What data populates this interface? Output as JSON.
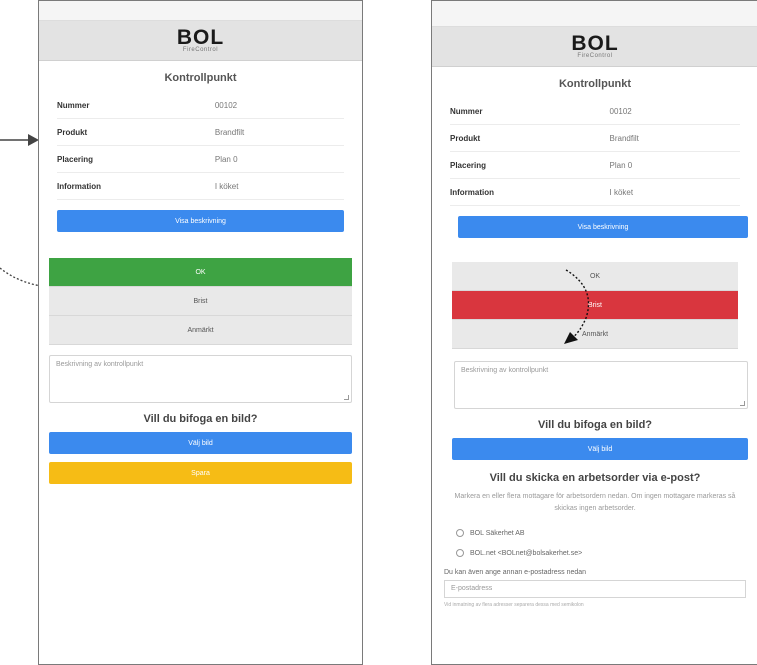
{
  "brand": {
    "name": "BOL",
    "tagline": "FireControl"
  },
  "left": {
    "title": "Kontrollpunkt",
    "rows": [
      {
        "label": "Nummer",
        "value": "00102"
      },
      {
        "label": "Produkt",
        "value": "Brandfilt"
      },
      {
        "label": "Placering",
        "value": "Plan 0"
      },
      {
        "label": "Information",
        "value": "I köket"
      }
    ],
    "show_description": "Visa beskrivning",
    "status": {
      "ok": "OK",
      "fail": "Brist",
      "remark": "Anmärkt"
    },
    "textarea_placeholder": "Beskrivning av kontrollpunkt",
    "attach_heading": "Vill du bifoga en bild?",
    "choose_image": "Välj bild",
    "save": "Spara"
  },
  "right": {
    "title": "Kontrollpunkt",
    "rows": [
      {
        "label": "Nummer",
        "value": "00102"
      },
      {
        "label": "Produkt",
        "value": "Brandfilt"
      },
      {
        "label": "Placering",
        "value": "Plan 0"
      },
      {
        "label": "Information",
        "value": "I köket"
      }
    ],
    "show_description": "Visa beskrivning",
    "status": {
      "ok": "OK",
      "fail": "Brist",
      "remark": "Anmärkt"
    },
    "textarea_placeholder": "Beskrivning av kontrollpunkt",
    "attach_heading": "Vill du bifoga en bild?",
    "choose_image": "Välj bild",
    "workorder_heading": "Vill du skicka en arbetsorder via e-post?",
    "workorder_hint": "Markera en eller flera mottagare för arbetsordern nedan. Om ingen mottagare markeras så skickas ingen arbetsorder.",
    "recipients": [
      "BOL Säkerhet AB",
      "BOL.net <BOLnet@bolsakerhet.se>"
    ],
    "email_label": "Du kan även ange annan e-postadress nedan",
    "email_placeholder": "E-postadress",
    "email_foot": "Vid inmatning av flera adresser separera dessa med semikolon"
  },
  "colors": {
    "ok": "#3ea343",
    "fail": "#d9363e",
    "primary": "#3b8aee",
    "save": "#f6bc15"
  }
}
